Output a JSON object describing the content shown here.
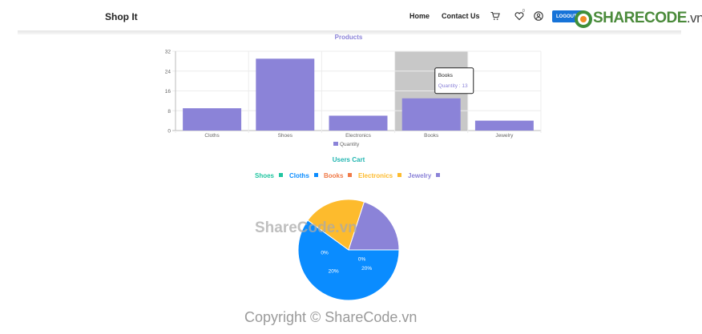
{
  "header": {
    "brand": "Shop It",
    "nav": {
      "home": "Home",
      "contact": "Contact Us"
    },
    "wishlist_badge": "0",
    "logout_label": "LOGOUT"
  },
  "watermark": {
    "logo_main": "SHARECODE",
    "logo_suffix": ".vn",
    "center": "ShareCode.vn",
    "copyright": "Copyright © ShareCode.vn"
  },
  "colors": {
    "bar": "#8b83d8",
    "hover_band": "#c8c8c8",
    "accent_blue": "#1673d8",
    "pie": [
      "#20c5a0",
      "#0a8cff",
      "#f07a48",
      "#fdbb2d",
      "#8b83d8"
    ]
  },
  "chart_data": [
    {
      "type": "bar",
      "title": "Products",
      "categories": [
        "Cloths",
        "Shoes",
        "Electronics",
        "Books",
        "Jewelry"
      ],
      "series": [
        {
          "name": "Quantity",
          "values": [
            9,
            29,
            6,
            13,
            4
          ]
        }
      ],
      "ylim": [
        0,
        32
      ],
      "yticks": [
        "0",
        "8",
        "16",
        "24",
        "32"
      ],
      "grid": true,
      "legend": "bottom",
      "highlighted": "Books",
      "tooltip": {
        "title": "Books",
        "label": "Quantity : 13"
      }
    },
    {
      "type": "pie",
      "title": "Users Cart",
      "labels": [
        "Shoes",
        "Cloths",
        "Books",
        "Electronics",
        "Jewelry"
      ],
      "values": [
        0,
        60,
        0,
        20,
        20
      ],
      "slice_labels": [
        "0%",
        "",
        "0%",
        "20%",
        "20%"
      ],
      "legend": "top"
    }
  ]
}
